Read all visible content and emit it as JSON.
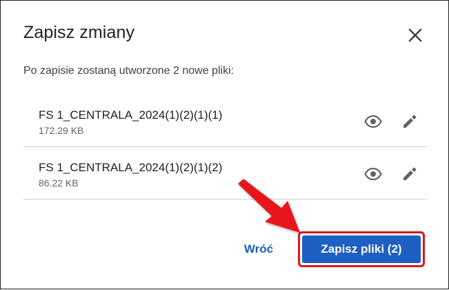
{
  "dialog": {
    "title": "Zapisz zmiany",
    "close_icon": "close-icon",
    "subtitle": "Po zapisie zostaną utworzone 2 nowe pliki:"
  },
  "files": [
    {
      "name": "FS 1_CENTRALA_2024(1)(2)(1)(1)",
      "size": "172.29 KB",
      "preview_icon": "eye-icon",
      "edit_icon": "pencil-icon"
    },
    {
      "name": "FS 1_CENTRALA_2024(1)(2)(1)(2)",
      "size": "86.22 KB",
      "preview_icon": "eye-icon",
      "edit_icon": "pencil-icon"
    }
  ],
  "actions": {
    "back_label": "Wróć",
    "save_label": "Zapisz pliki (2)"
  },
  "colors": {
    "primary": "#1e5fc2",
    "link": "#1a5fb4",
    "annotation": "#d6161d",
    "icon": "#5f6368"
  }
}
